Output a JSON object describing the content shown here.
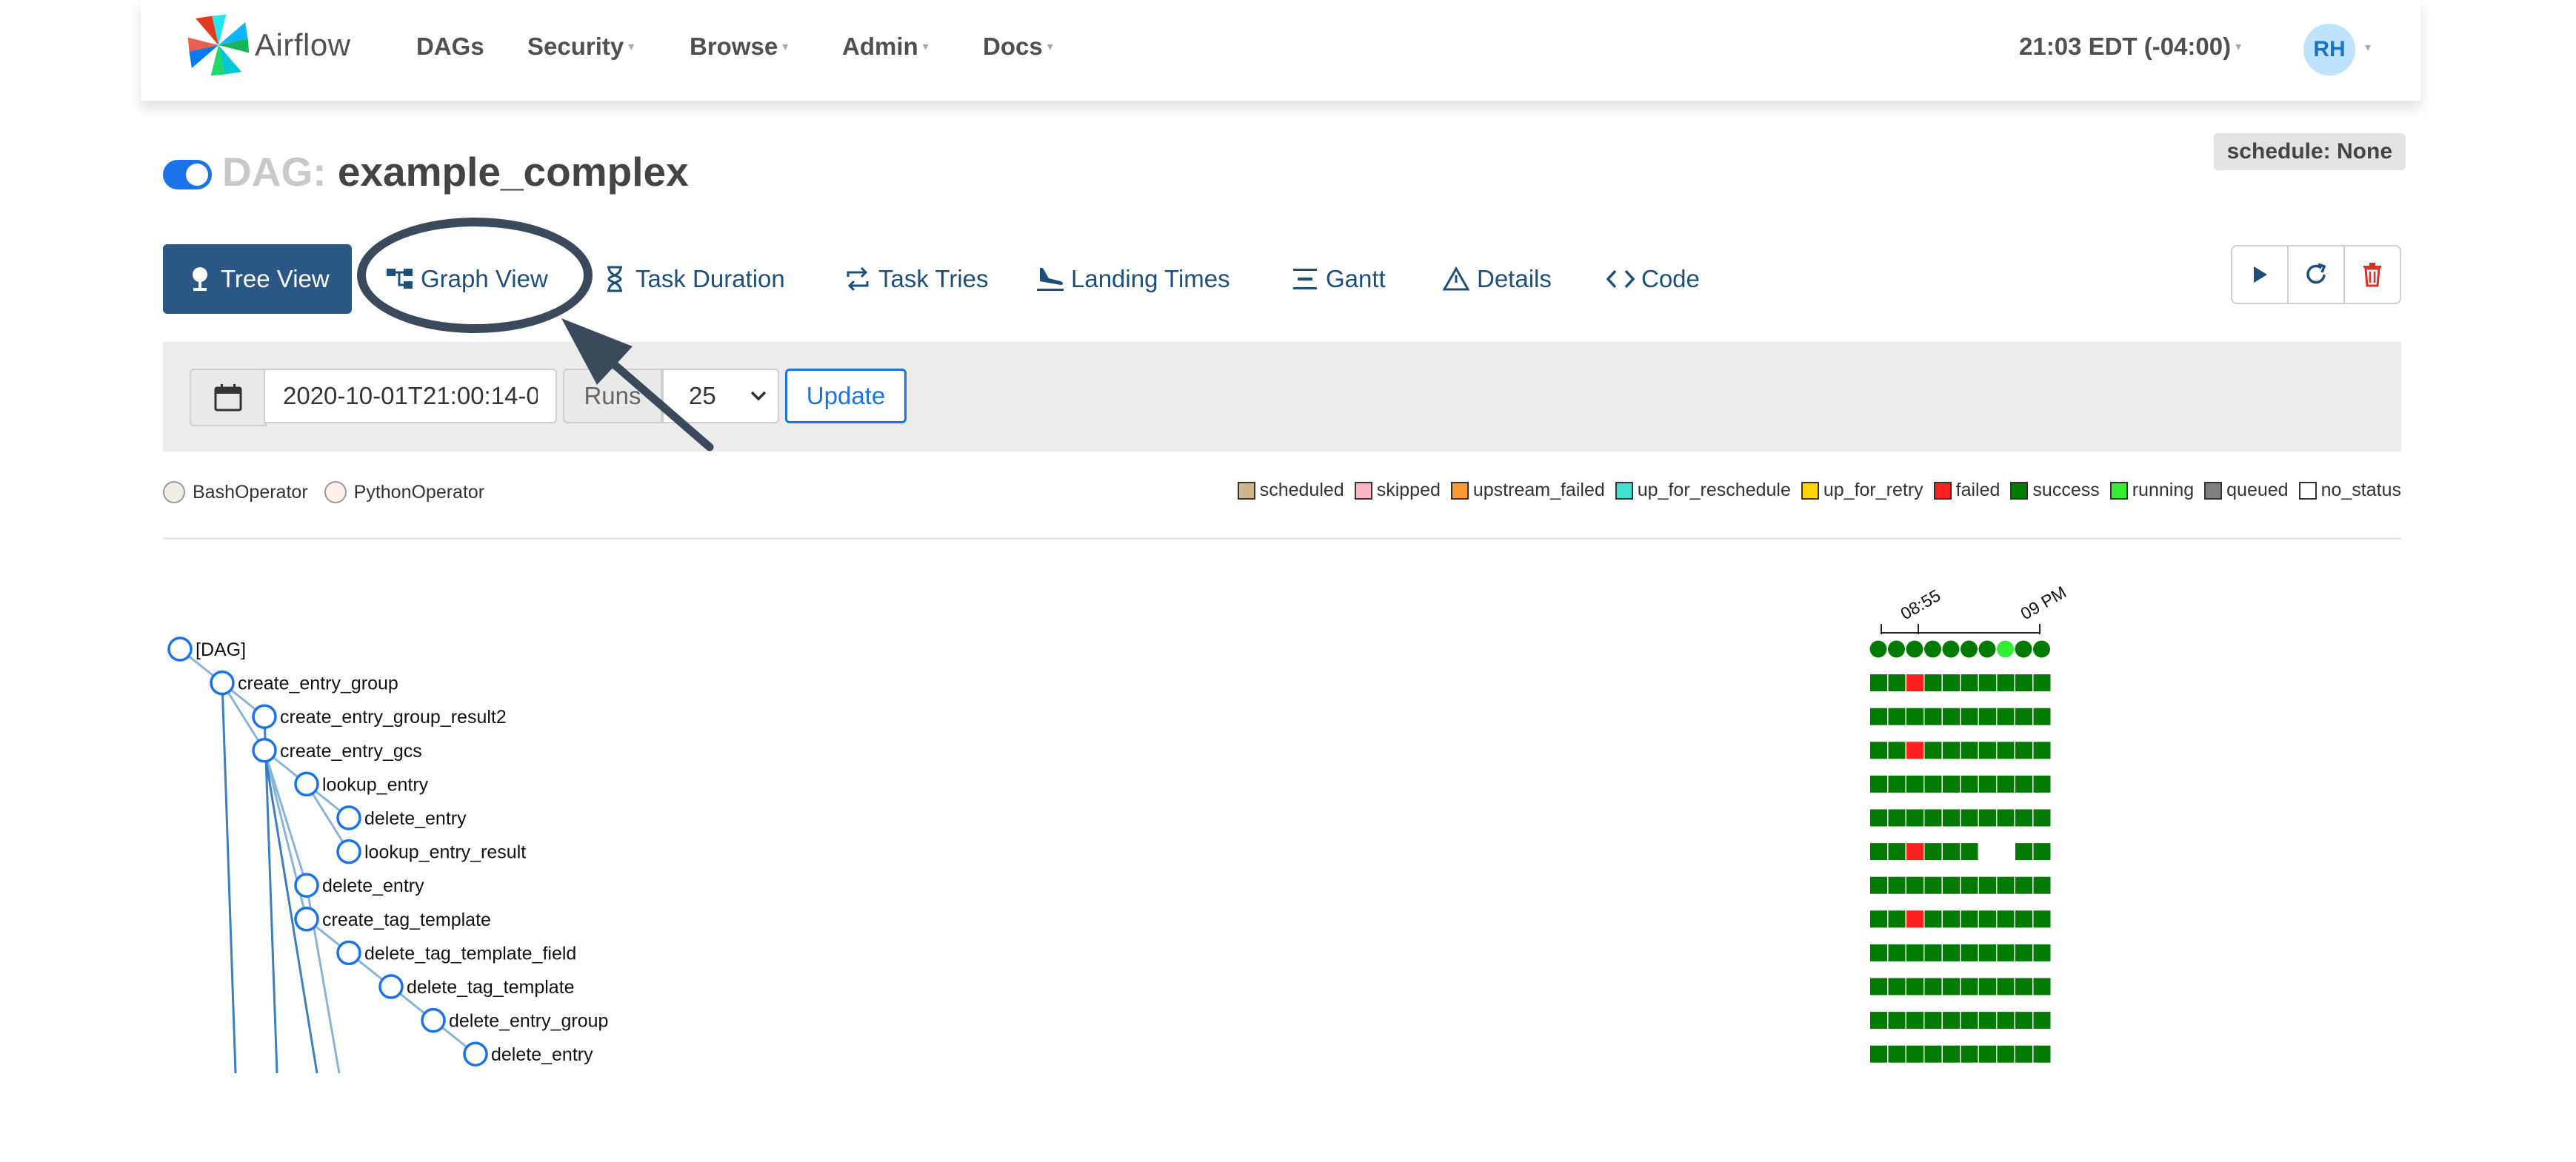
{
  "navbar": {
    "brand": "Airflow",
    "items": [
      {
        "label": "DAGs",
        "dropdown": false
      },
      {
        "label": "Security",
        "dropdown": true
      },
      {
        "label": "Browse",
        "dropdown": true
      },
      {
        "label": "Admin",
        "dropdown": true
      },
      {
        "label": "Docs",
        "dropdown": true
      }
    ],
    "time": "21:03 EDT (-04:00)",
    "avatar": "RH"
  },
  "dag": {
    "prefix": "DAG:",
    "name": "example_complex",
    "enabled": true,
    "schedule": "schedule: None"
  },
  "tabs": [
    {
      "label": "Tree View",
      "icon": "tree-icon",
      "active": true
    },
    {
      "label": "Graph View",
      "icon": "graph-icon",
      "active": false
    },
    {
      "label": "Task Duration",
      "icon": "hourglass-icon",
      "active": false
    },
    {
      "label": "Task Tries",
      "icon": "retry-icon",
      "active": false
    },
    {
      "label": "Landing Times",
      "icon": "plane-landing-icon",
      "active": false
    },
    {
      "label": "Gantt",
      "icon": "gantt-icon",
      "active": false
    },
    {
      "label": "Details",
      "icon": "warning-triangle-icon",
      "active": false
    },
    {
      "label": "Code",
      "icon": "code-icon",
      "active": false
    }
  ],
  "actions": [
    {
      "name": "trigger-dag-button",
      "icon": "play-icon"
    },
    {
      "name": "refresh-button",
      "icon": "refresh-icon"
    },
    {
      "name": "delete-dag-button",
      "icon": "trash-icon"
    }
  ],
  "form": {
    "date_value": "2020-10-01T21:00:14-0",
    "runs_label": "Runs",
    "runs_value": "25",
    "update_label": "Update"
  },
  "operator_legend": [
    {
      "label": "BashOperator",
      "color": "#f0ede4"
    },
    {
      "label": "PythonOperator",
      "color": "#ffefeb"
    }
  ],
  "state_legend": [
    {
      "label": "scheduled",
      "color": "#d2b48c"
    },
    {
      "label": "skipped",
      "color": "#ffb6c1"
    },
    {
      "label": "upstream_failed",
      "color": "#ff9933"
    },
    {
      "label": "up_for_reschedule",
      "color": "#40e0d0"
    },
    {
      "label": "up_for_retry",
      "color": "#ffd700"
    },
    {
      "label": "failed",
      "color": "#ff2020"
    },
    {
      "label": "success",
      "color": "#007a00"
    },
    {
      "label": "running",
      "color": "#33ee33"
    },
    {
      "label": "queued",
      "color": "#808080"
    },
    {
      "label": "no_status",
      "color": "#ffffff"
    }
  ],
  "timeline": {
    "ticks": [
      "08:55",
      "09 PM"
    ]
  },
  "tree": {
    "nodes": [
      {
        "label": "[DAG]",
        "depth": 0
      },
      {
        "label": "create_entry_group",
        "depth": 1
      },
      {
        "label": "create_entry_group_result2",
        "depth": 2
      },
      {
        "label": "create_entry_gcs",
        "depth": 2
      },
      {
        "label": "lookup_entry",
        "depth": 3
      },
      {
        "label": "delete_entry",
        "depth": 4
      },
      {
        "label": "lookup_entry_result",
        "depth": 4
      },
      {
        "label": "delete_entry",
        "depth": 3
      },
      {
        "label": "create_tag_template",
        "depth": 3
      },
      {
        "label": "delete_tag_template_field",
        "depth": 4
      },
      {
        "label": "delete_tag_template",
        "depth": 5
      },
      {
        "label": "delete_entry_group",
        "depth": 6
      },
      {
        "label": "delete_entry",
        "depth": 7
      }
    ]
  },
  "grid": {
    "colors": {
      "success": "#007a00",
      "failed": "#ff2020",
      "running": "#33ee33",
      "none": "#ffffff"
    },
    "dag_runs": [
      "success",
      "success",
      "success",
      "success",
      "success",
      "success",
      "success",
      "running",
      "success",
      "success"
    ],
    "task_rows": [
      [
        "success",
        "success",
        "failed",
        "success",
        "success",
        "success",
        "success",
        "success",
        "success",
        "success"
      ],
      [
        "success",
        "success",
        "success",
        "success",
        "success",
        "success",
        "success",
        "success",
        "success",
        "success"
      ],
      [
        "success",
        "success",
        "failed",
        "success",
        "success",
        "success",
        "success",
        "success",
        "success",
        "success"
      ],
      [
        "success",
        "success",
        "success",
        "success",
        "success",
        "success",
        "success",
        "success",
        "success",
        "success"
      ],
      [
        "success",
        "success",
        "success",
        "success",
        "success",
        "success",
        "success",
        "success",
        "success",
        "success"
      ],
      [
        "success",
        "success",
        "failed",
        "success",
        "success",
        "success",
        "none",
        "none",
        "success",
        "success"
      ],
      [
        "success",
        "success",
        "success",
        "success",
        "success",
        "success",
        "success",
        "success",
        "success",
        "success"
      ],
      [
        "success",
        "success",
        "failed",
        "success",
        "success",
        "success",
        "success",
        "success",
        "success",
        "success"
      ],
      [
        "success",
        "success",
        "success",
        "success",
        "success",
        "success",
        "success",
        "success",
        "success",
        "success"
      ],
      [
        "success",
        "success",
        "success",
        "success",
        "success",
        "success",
        "success",
        "success",
        "success",
        "success"
      ],
      [
        "success",
        "success",
        "success",
        "success",
        "success",
        "success",
        "success",
        "success",
        "success",
        "success"
      ],
      [
        "success",
        "success",
        "success",
        "success",
        "success",
        "success",
        "success",
        "success",
        "success",
        "success"
      ]
    ]
  }
}
